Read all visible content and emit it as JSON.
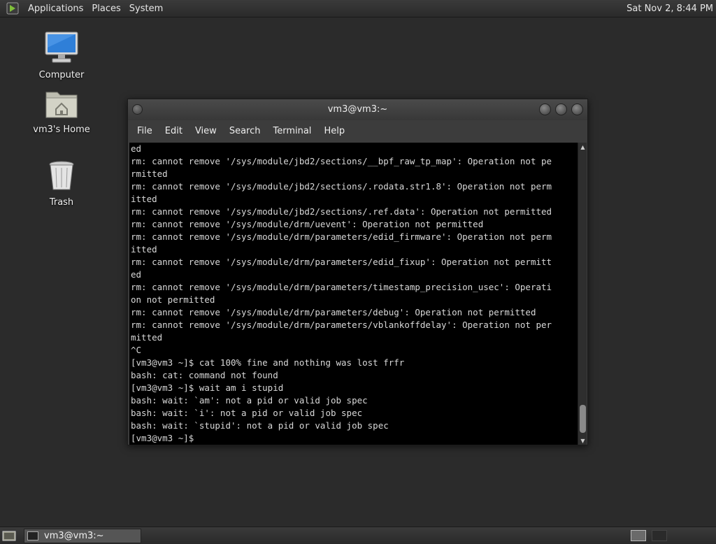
{
  "top_panel": {
    "menus": [
      "Applications",
      "Places",
      "System"
    ],
    "clock": "Sat Nov 2,  8:44 PM"
  },
  "desktop": {
    "icons": [
      {
        "label": "Computer",
        "icon": "computer-icon"
      },
      {
        "label": "vm3's Home",
        "icon": "home-folder-icon"
      },
      {
        "label": "Trash",
        "icon": "trash-icon"
      }
    ]
  },
  "terminal": {
    "title": "vm3@vm3:~",
    "menu": [
      "File",
      "Edit",
      "View",
      "Search",
      "Terminal",
      "Help"
    ],
    "lines": [
      "ed",
      "rm: cannot remove '/sys/module/jbd2/sections/__bpf_raw_tp_map': Operation not pe",
      "rmitted",
      "rm: cannot remove '/sys/module/jbd2/sections/.rodata.str1.8': Operation not perm",
      "itted",
      "rm: cannot remove '/sys/module/jbd2/sections/.ref.data': Operation not permitted",
      "rm: cannot remove '/sys/module/drm/uevent': Operation not permitted",
      "rm: cannot remove '/sys/module/drm/parameters/edid_firmware': Operation not perm",
      "itted",
      "rm: cannot remove '/sys/module/drm/parameters/edid_fixup': Operation not permitt",
      "ed",
      "rm: cannot remove '/sys/module/drm/parameters/timestamp_precision_usec': Operati",
      "on not permitted",
      "rm: cannot remove '/sys/module/drm/parameters/debug': Operation not permitted",
      "rm: cannot remove '/sys/module/drm/parameters/vblankoffdelay': Operation not per",
      "mitted",
      "^C",
      "[vm3@vm3 ~]$ cat 100% fine and nothing was lost frfr",
      "bash: cat: command not found",
      "[vm3@vm3 ~]$ wait am i stupid",
      "bash: wait: `am': not a pid or valid job spec",
      "bash: wait: `i': not a pid or valid job spec",
      "bash: wait: `stupid': not a pid or valid job spec",
      "[vm3@vm3 ~]$ "
    ]
  },
  "taskbar": {
    "task_label": "vm3@vm3:~"
  }
}
